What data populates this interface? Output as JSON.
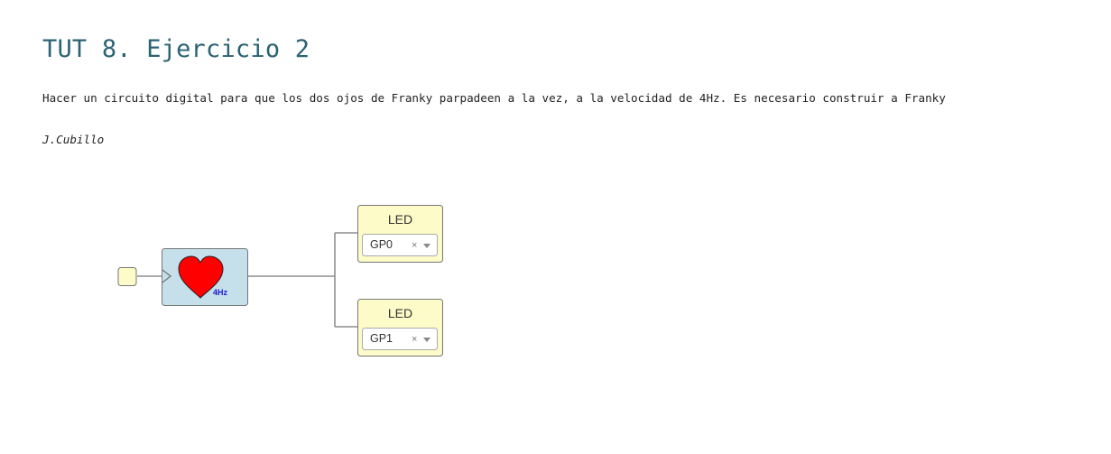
{
  "header": {
    "title": "TUT 8. Ejercicio 2",
    "description": "Hacer un circuito digital para que los dos ojos de Franky parpadeen a la vez, a la velocidad de 4Hz. Es necesario construir a Franky",
    "author": "J.Cubillo"
  },
  "diagram": {
    "heart_block": {
      "frequency_label": "4Hz",
      "icon": "heart-icon",
      "color": "#ff0000",
      "background": "#c5dfeb"
    },
    "led_blocks": [
      {
        "label": "LED",
        "selected_pin": "GP0",
        "clear_symbol": "×"
      },
      {
        "label": "LED",
        "selected_pin": "GP1",
        "clear_symbol": "×"
      }
    ],
    "colors": {
      "led_background": "#fdfbc8",
      "input_background": "#fdfbc8",
      "wire": "#777777",
      "title": "#2a6373"
    }
  }
}
